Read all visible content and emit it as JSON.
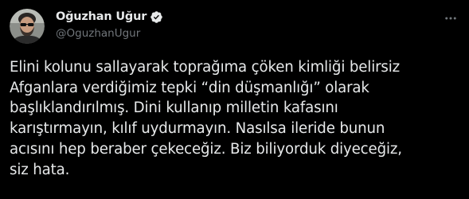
{
  "author": {
    "display_name": "Oğuzhan Uğur",
    "handle": "@OguzhanUgur",
    "verified": true,
    "avatar_icon": "profile-photo"
  },
  "tweet": {
    "text": "Elini kolunu sallayarak toprağıma çöken kimliği belirsiz\nAfganlara verdiğimiz tepki “din düşmanlığı” olarak\nbaşlıklandırılmış. Dini kullanıp milletin kafasını\nkarıştırmayın, kılıf uydurmayın. Nasılsa ileride bunun\nacısını hep beraber çekeceğiz. Biz biliyorduk diyeceğiz,\nsiz hata."
  },
  "icons": {
    "verified": "verified-badge-icon",
    "more": "more-options-icon"
  },
  "colors": {
    "background": "#000000",
    "text_primary": "#e7e9ea",
    "text_secondary": "#71767b",
    "verified_badge": "#1d9bf0"
  }
}
